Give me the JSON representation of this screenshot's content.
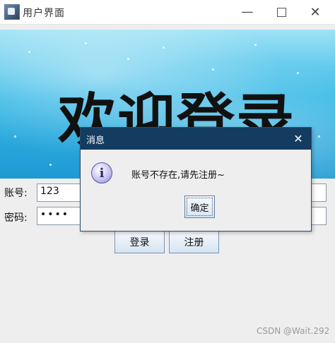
{
  "window": {
    "title": "用户界面",
    "controls": {
      "minimize": "—",
      "maximize": "",
      "close": "✕"
    }
  },
  "banner": {
    "title": "欢迎登录"
  },
  "form": {
    "account_label": "账号:",
    "account_value": "123",
    "password_label": "密码:",
    "password_value": "••••",
    "login_button": "登录",
    "register_button": "注册"
  },
  "dialog": {
    "title": "消息",
    "close": "✕",
    "icon": "i",
    "message": "账号不存在,请先注册~",
    "ok_button": "确定"
  },
  "watermark": "CSDN @Wait.292"
}
